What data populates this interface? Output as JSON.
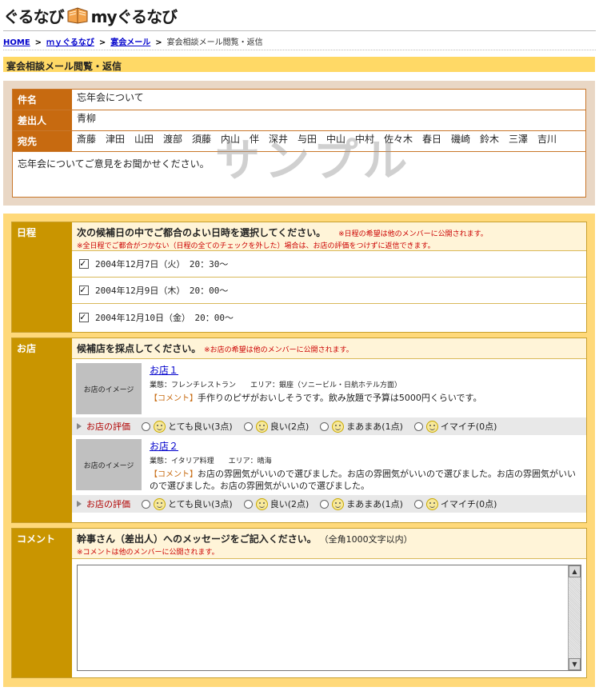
{
  "logo": {
    "left": "ぐるなび",
    "right": "myぐるなび"
  },
  "breadcrumb": {
    "home": "HOME",
    "mygurunavi": "ｍｙぐるなび",
    "enkai_mail": "宴会メール",
    "current": "宴会相談メール閲覧・返信"
  },
  "page_title": "宴会相談メール閲覧・返信",
  "message": {
    "subject_label": "件名",
    "subject": "忘年会について",
    "sender_label": "差出人",
    "sender": "青柳",
    "to_label": "宛先",
    "to": "斎藤　津田　山田　渡部　須藤　内山　伴　深井　与田　中山　中村　佐々木　春日　磯崎　鈴木　三澤　吉川",
    "body": "忘年会についてご意見をお聞かせください。",
    "watermark": "サンプル"
  },
  "schedule": {
    "label": "日程",
    "heading": "次の候補日の中でご都合のよい日時を選択してください。",
    "note1": "※日程の希望は他のメンバーに公開されます。",
    "note2": "※全日程でご都合がつかない（日程の全てのチェックを外した）場合は、お店の評価をつけずに返信できます。",
    "dates": [
      {
        "text": "2004年12月7日（火）　20：30～",
        "checked": true
      },
      {
        "text": "2004年12月9日（木）　20：00～",
        "checked": true
      },
      {
        "text": "2004年12月10日（金）　20：00～",
        "checked": true
      }
    ]
  },
  "shops": {
    "label": "お店",
    "heading": "候補店を採点してください。",
    "note": "※お店の希望は他のメンバーに公開されます。",
    "image_text": "お店のイメージ",
    "eval_label": "お店の評価",
    "options": [
      "とても良い(3点)",
      "良い(2点)",
      "まあまあ(1点)",
      "イマイチ(0点)"
    ],
    "items": [
      {
        "name": "お店１",
        "meta": "業態：フレンチレストラン　　エリア：銀座（ソニービル・日航ホテル方面）",
        "comment_tag": "【コメント】",
        "comment": "手作りのピザがおいしそうです。飲み放題で予算は5000円くらいです。"
      },
      {
        "name": "お店２",
        "meta": "業態：イタリア料理　　エリア：晴海",
        "comment_tag": "【コメント】",
        "comment": "お店の雰囲気がいいので選びました。お店の雰囲気がいいので選びました。お店の雰囲気がいいので選びました。お店の雰囲気がいいので選びました。"
      }
    ]
  },
  "comment": {
    "label": "コメント",
    "heading": "幹事さん（差出人）へのメッセージをご記入ください。",
    "limit": "（全角1000文字以内）",
    "note": "※コメントは他のメンバーに公開されます。",
    "value": ""
  }
}
